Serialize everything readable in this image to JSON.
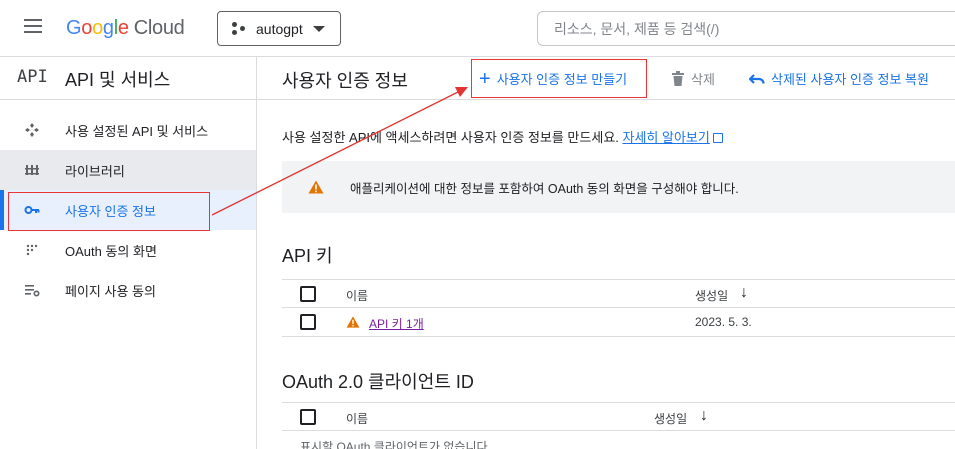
{
  "topbar": {
    "logo": {
      "letters": [
        "G",
        "o",
        "o",
        "g",
        "l",
        "e"
      ],
      "product": "Cloud"
    },
    "project": {
      "name": "autogpt"
    },
    "search": {
      "placeholder": "리소스, 문서, 제품 등 검색(/)"
    }
  },
  "sidenav": {
    "badge": "API",
    "title": "API 및 서비스",
    "items": [
      {
        "label": "사용 설정된 API 및 서비스",
        "icon": "enabled-apis-icon"
      },
      {
        "label": "라이브러리",
        "icon": "library-icon"
      },
      {
        "label": "사용자 인증 정보",
        "icon": "key-icon",
        "active": true
      },
      {
        "label": "OAuth 동의 화면",
        "icon": "consent-screen-icon"
      },
      {
        "label": "페이지 사용 동의",
        "icon": "page-usage-icon"
      }
    ]
  },
  "main": {
    "title": "사용자 인증 정보",
    "toolbar": {
      "create": "사용자 인증 정보 만들기",
      "delete": "삭제",
      "restore": "삭제된 사용자 인증 정보 복원"
    },
    "intro": "사용 설정한 API에 액세스하려면 사용자 인증 정보를 만드세요.",
    "intro_link": "자세히 알아보기",
    "warning": "애플리케이션에 대한 정보를 포함하여 OAuth 동의 화면을 구성해야 합니다.",
    "api_keys": {
      "title": "API 키",
      "headers": {
        "name": "이름",
        "created": "생성일"
      },
      "rows": [
        {
          "name": "API 키 1개",
          "created": "2023. 5. 3."
        }
      ]
    },
    "oauth": {
      "title": "OAuth 2.0 클라이언트 ID",
      "headers": {
        "name": "이름",
        "created": "생성일"
      },
      "empty": "표시할 OAuth 클라이언트가 없습니다."
    }
  },
  "colors": {
    "accent": "#1a73e8",
    "annotation": "#e33333",
    "warning": "#e37400"
  }
}
